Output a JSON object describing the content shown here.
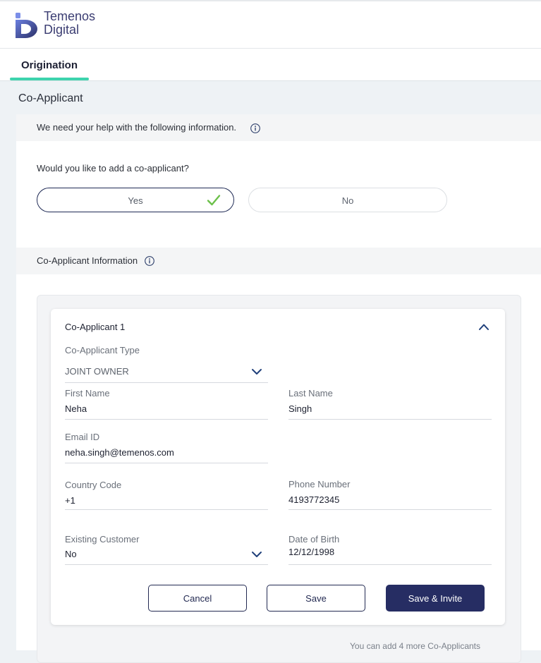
{
  "brand": {
    "line1": "Temenos",
    "line2": "Digital",
    "color": "#3b3d72"
  },
  "tabs": [
    {
      "label": "Origination",
      "active": true
    }
  ],
  "page": {
    "title": "Co-Applicant"
  },
  "help_section": {
    "text": "We need your help with the following information."
  },
  "question": {
    "text": "Would you like to add a co-applicant?",
    "yes_label": "Yes",
    "no_label": "No",
    "selected": "Yes"
  },
  "info_section": {
    "text": "Co-Applicant Information"
  },
  "co_applicant": {
    "title": "Co-Applicant 1",
    "type": {
      "label": "Co-Applicant Type",
      "value": "JOINT OWNER"
    },
    "first_name": {
      "label": "First Name",
      "value": "Neha"
    },
    "last_name": {
      "label": "Last Name",
      "value": "Singh"
    },
    "email": {
      "label": "Email ID",
      "value": "neha.singh@temenos.com"
    },
    "country_code": {
      "label": "Country Code",
      "value": "+1"
    },
    "phone": {
      "label": "Phone Number",
      "value": "4193772345"
    },
    "existing_customer": {
      "label": "Existing Customer",
      "value": "No"
    },
    "dob": {
      "label": "Date of Birth",
      "value": "12/12/1998"
    }
  },
  "buttons": {
    "cancel": "Cancel",
    "save": "Save",
    "save_invite": "Save & Invite"
  },
  "footnote": "You can add 4 more Co-Applicants",
  "icons": [
    "logo-icon",
    "info-icon",
    "check-icon",
    "chevron-up-icon",
    "chevron-down-icon"
  ],
  "colors": {
    "accent": "#3dd3ad",
    "primary": "#262d63",
    "check": "#6cc04a"
  }
}
